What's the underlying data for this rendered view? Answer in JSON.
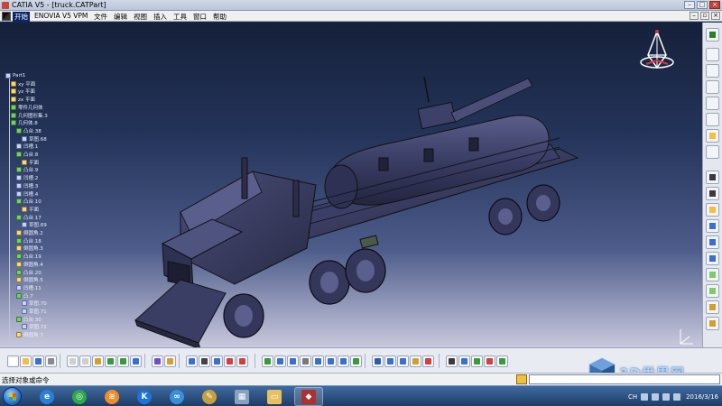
{
  "window": {
    "title": "CATIA V5 - [truck.CATPart]"
  },
  "menubar": {
    "items": [
      "开始",
      "ENOVIA V5 VPM",
      "文件",
      "编辑",
      "视图",
      "插入",
      "工具",
      "窗口",
      "帮助"
    ]
  },
  "tree": {
    "nodes": [
      {
        "label": "Part1",
        "icon": "part-icon",
        "level": 0
      },
      {
        "label": "xy 平面",
        "icon": "plane-icon",
        "level": 1
      },
      {
        "label": "yz 平面",
        "icon": "plane-icon",
        "level": 1
      },
      {
        "label": "zx 平面",
        "icon": "plane-icon",
        "level": 1
      },
      {
        "label": "零件几何体",
        "icon": "body-icon",
        "level": 1
      },
      {
        "label": "几何图形集.3",
        "icon": "geoset-icon",
        "level": 1
      },
      {
        "label": "几何体.8",
        "icon": "body-icon",
        "level": 1
      },
      {
        "label": "凸台.38",
        "icon": "pad-icon",
        "level": 2
      },
      {
        "label": "草图.68",
        "icon": "sketch-icon",
        "level": 3
      },
      {
        "label": "凹槽.1",
        "icon": "pocket-icon",
        "level": 2
      },
      {
        "label": "凸台.8",
        "icon": "pad-icon",
        "level": 2
      },
      {
        "label": "平面",
        "icon": "plane-icon",
        "level": 3
      },
      {
        "label": "凸台.9",
        "icon": "pad-icon",
        "level": 2
      },
      {
        "label": "凹槽.2",
        "icon": "pocket-icon",
        "level": 2
      },
      {
        "label": "凹槽.3",
        "icon": "pocket-icon",
        "level": 2
      },
      {
        "label": "凹槽.4",
        "icon": "pocket-icon",
        "level": 2
      },
      {
        "label": "凸台.10",
        "icon": "pad-icon",
        "level": 2
      },
      {
        "label": "平面",
        "icon": "plane-icon",
        "level": 3
      },
      {
        "label": "凸台.17",
        "icon": "pad-icon",
        "level": 2
      },
      {
        "label": "草图.69",
        "icon": "sketch-icon",
        "level": 3
      },
      {
        "label": "倒圆角.2",
        "icon": "fillet-icon",
        "level": 2
      },
      {
        "label": "凸台.18",
        "icon": "pad-icon",
        "level": 2
      },
      {
        "label": "倒圆角.3",
        "icon": "fillet-icon",
        "level": 2
      },
      {
        "label": "凸台.19",
        "icon": "pad-icon",
        "level": 2
      },
      {
        "label": "倒圆角.4",
        "icon": "fillet-icon",
        "level": 2
      },
      {
        "label": "凸台.20",
        "icon": "pad-icon",
        "level": 2
      },
      {
        "label": "倒圆角.5",
        "icon": "fillet-icon",
        "level": 2
      },
      {
        "label": "凹槽.11",
        "icon": "pocket-icon",
        "level": 2
      },
      {
        "label": "凸.7",
        "icon": "pad-icon",
        "level": 2
      },
      {
        "label": "草图.70",
        "icon": "sketch-icon",
        "level": 3
      },
      {
        "label": "草图.71",
        "icon": "sketch-icon",
        "level": 3
      },
      {
        "label": "凸台.30",
        "icon": "pad-icon",
        "level": 2
      },
      {
        "label": "草图.72",
        "icon": "sketch-icon",
        "level": 3
      },
      {
        "label": "倒圆角.7",
        "icon": "fillet-icon",
        "level": 2
      }
    ]
  },
  "statusbar": {
    "text": "选择对象或命令"
  },
  "taskbar": {
    "lang": "CH",
    "date": "2016/3/16"
  },
  "watermark": {
    "text": "3D世界网"
  },
  "colors": {
    "bg_top": "#15203a",
    "bg_bottom": "#c9c9de",
    "model": "#3a3d64",
    "accent": "#0a246a"
  }
}
